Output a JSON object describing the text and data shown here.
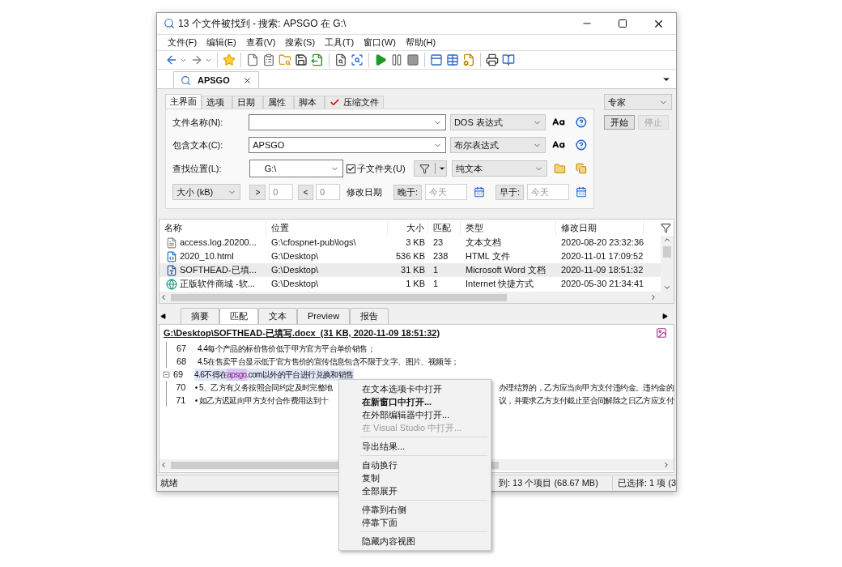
{
  "window": {
    "title": "13 个文件被找到 - 搜索: APSGO 在 G:\\"
  },
  "menu": [
    "文件(F)",
    "编辑(E)",
    "查看(V)",
    "搜索(S)",
    "工具(T)",
    "窗口(W)",
    "帮助(H)"
  ],
  "document_tabs": [
    {
      "label": "APSGO",
      "selected": true
    }
  ],
  "search_tabs": [
    {
      "label": "主界面",
      "selected": true,
      "checked": false
    },
    {
      "label": "选项",
      "selected": false,
      "checked": false
    },
    {
      "label": "日期",
      "selected": false,
      "checked": false
    },
    {
      "label": "属性",
      "selected": false,
      "checked": false
    },
    {
      "label": "脚本",
      "selected": false,
      "checked": false
    },
    {
      "label": "压缩文件",
      "selected": false,
      "checked": true
    }
  ],
  "file_name": {
    "label": "文件名称(N):",
    "mode": "DOS 表达式"
  },
  "contains_text": {
    "label": "包含文本(C):",
    "value": "APSGO",
    "mode": "布尔表达式"
  },
  "location": {
    "label": "查找位置(L):",
    "value": "G:\\",
    "subfolders": {
      "label": "子文件夹(U)",
      "checked": true
    },
    "mode": "纯文本"
  },
  "size_filter": {
    "unit": "大小 (kB)",
    "greater": ">",
    "greater_value": "0",
    "less": "<",
    "less_value": "0",
    "date_label": "修改日期",
    "after": "晚于:",
    "after_placeholder": "今天",
    "before": "早于:",
    "before_placeholder": "今天"
  },
  "search_mode": "专家",
  "actions": [
    {
      "label": "开始",
      "disabled": false
    },
    {
      "label": "停止",
      "disabled": true
    }
  ],
  "results": {
    "columns": [
      "名称",
      "位置",
      "大小",
      "匹配",
      "类型",
      "修改日期"
    ],
    "rows": [
      {
        "kind": "text",
        "name": "access.log.20200...",
        "location": "G:\\cfospnet-pub\\logs\\",
        "size": "3 KB",
        "matches": "23",
        "type": "文本文档",
        "modified": "2020-08-20 23:32:36",
        "selected": false
      },
      {
        "kind": "html",
        "name": "2020_10.html",
        "location": "G:\\Desktop\\",
        "size": "536 KB",
        "matches": "238",
        "type": "HTML 文件",
        "modified": "2020-11-01 17:09:52",
        "selected": false
      },
      {
        "kind": "word",
        "name": "SOFTHEAD-已填...",
        "location": "G:\\Desktop\\",
        "size": "31 KB",
        "matches": "1",
        "type": "Microsoft Word 文档",
        "modified": "2020-11-09 18:51:32",
        "selected": true
      },
      {
        "kind": "shortcut",
        "name": "正版软件商城 -软...",
        "location": "G:\\Desktop\\",
        "size": "1 KB",
        "matches": "1",
        "type": "Internet 快捷方式",
        "modified": "2020-05-30 21:34:41",
        "selected": false
      }
    ]
  },
  "bottom_tabs": [
    {
      "label": "摘要",
      "selected": false
    },
    {
      "label": "匹配",
      "selected": true
    },
    {
      "label": "文本",
      "selected": false
    },
    {
      "label": "Preview",
      "selected": false
    },
    {
      "label": "报告",
      "selected": false
    }
  ],
  "file_heading": "G:\\Desktop\\SOFTHEAD-已填写.docx  (31 KB, 2020-11-09 18:51:32)",
  "lines": [
    {
      "number": "67",
      "parts": [
        {
          "text": "4.4每个产品的标价售价低于甲方官方平台单价销售；",
          "match": false
        }
      ],
      "selected": false,
      "expanded": false
    },
    {
      "number": "68",
      "parts": [
        {
          "text": "4.5在售卖平台显示低于官方售价的宣传信息包含不限于文字、图片、视频等；",
          "match": false
        }
      ],
      "selected": false,
      "expanded": false
    },
    {
      "number": "69",
      "parts": [
        {
          "text": "4.6不得在",
          "match": false
        },
        {
          "text": "apsgo",
          "match": true
        },
        {
          "text": ".com以外的平台进行兑换和销售",
          "match": false
        }
      ],
      "selected": true,
      "expanded": true
    },
    {
      "number": "70",
      "parts": [
        {
          "text": "• 5、乙方有义务按照合同约定及时完整地",
          "match": false
        },
        {
          "text": "办理结算的，乙方应当向甲方支付违约金。违约金的",
          "match": false
        }
      ],
      "selected": false,
      "expanded": false
    },
    {
      "number": "71",
      "parts": [
        {
          "text": "• 如乙方迟延向甲方支付合作费用达到十",
          "match": false
        },
        {
          "text": "议，并要求乙方支付截止至合同解除之日乙方应支付",
          "match": false
        }
      ],
      "selected": false,
      "expanded": false
    }
  ],
  "context_menu": [
    {
      "kind": "item",
      "label": "在文本选项卡中打开",
      "default": false,
      "disabled": false
    },
    {
      "kind": "item",
      "label": "在新窗口中打开...",
      "default": true,
      "disabled": false
    },
    {
      "kind": "item",
      "label": "在外部编辑器中打开...",
      "default": false,
      "disabled": false
    },
    {
      "kind": "item",
      "label": "在 Visual Studio 中打开...",
      "default": false,
      "disabled": true
    },
    {
      "kind": "separator"
    },
    {
      "kind": "item",
      "label": "导出结果...",
      "default": false,
      "disabled": false
    },
    {
      "kind": "separator"
    },
    {
      "kind": "item",
      "label": "自动换行",
      "default": false,
      "disabled": false
    },
    {
      "kind": "item",
      "label": "复制",
      "default": false,
      "disabled": false
    },
    {
      "kind": "item",
      "label": "全部展开",
      "default": false,
      "disabled": false
    },
    {
      "kind": "separator"
    },
    {
      "kind": "item",
      "label": "停靠到右侧",
      "default": false,
      "disabled": false
    },
    {
      "kind": "item",
      "label": "停靠下面",
      "default": false,
      "disabled": false
    },
    {
      "kind": "separator"
    },
    {
      "kind": "item",
      "label": "隐藏内容视图",
      "default": false,
      "disabled": false
    }
  ],
  "status_bar": [
    "就绪",
    "到: 13 个项目 (68.67 MB)",
    "已选择: 1 项 (3"
  ]
}
